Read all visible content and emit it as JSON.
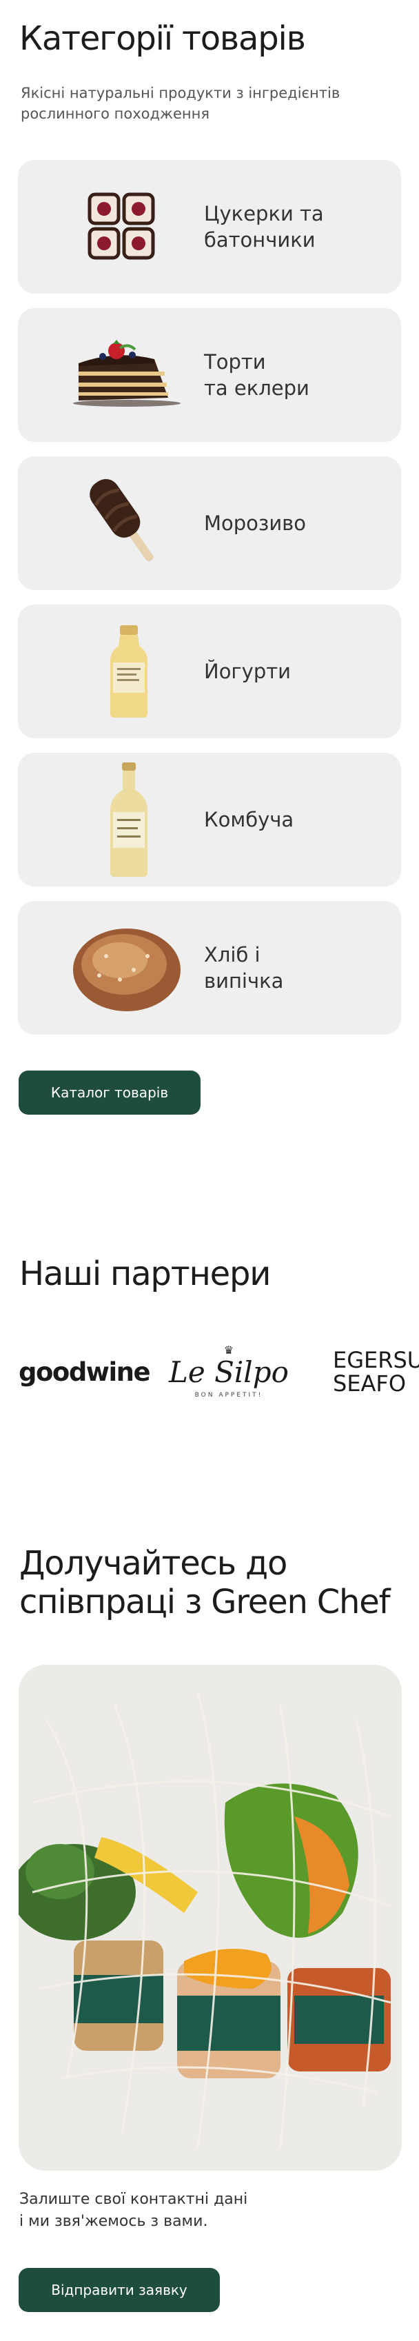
{
  "categories_section": {
    "title": "Категорії товарів",
    "subtitle": "Якісні натуральні продукти з інгредієнтів рослинного походження",
    "items": [
      {
        "label": "Цукерки та\nбатончики",
        "icon": "candy-bars-icon"
      },
      {
        "label": "Торти\nта еклери",
        "icon": "cake-slice-icon"
      },
      {
        "label": "Морозиво",
        "icon": "ice-cream-icon"
      },
      {
        "label": "Йогурти",
        "icon": "yogurt-bottle-icon"
      },
      {
        "label": "Комбуча",
        "icon": "kombucha-bottle-icon"
      },
      {
        "label": "Хліб і\nвипічка",
        "icon": "bread-loaf-icon"
      }
    ],
    "catalog_button": "Каталог товарів"
  },
  "partners_section": {
    "title": "Наші партнери",
    "partners": [
      {
        "name": "goodwine"
      },
      {
        "name": "Le Silpo",
        "tagline": "BON APPETIT!"
      },
      {
        "name_line1": "EGERSU",
        "name_line2": "SEAFO"
      }
    ]
  },
  "join_section": {
    "title_line1": "Долучайтесь до",
    "title_line2": "співпраці з Green Chef",
    "contact_text": "Залиште свої контактні дані\nі ми звя'жемось з вами.",
    "submit_button": "Відправити заявку"
  },
  "colors": {
    "accent": "#1f4d3d",
    "card_bg": "#efefef",
    "text": "#222222"
  }
}
